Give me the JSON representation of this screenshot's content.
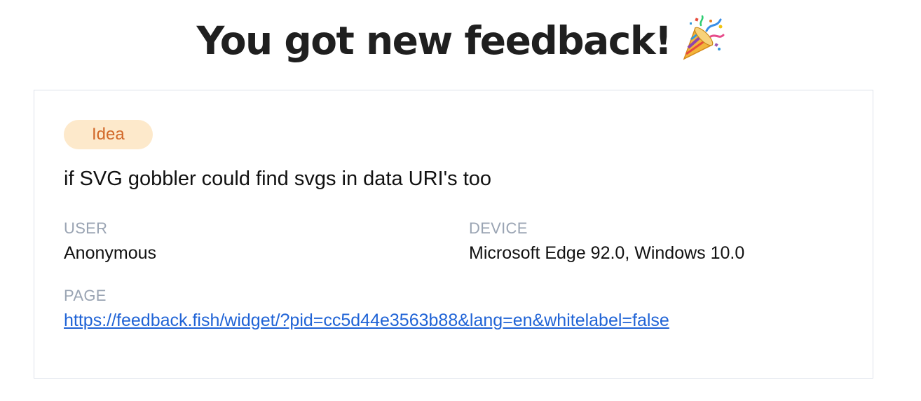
{
  "header": {
    "title": "You got new feedback!",
    "icon": "party-popper-icon"
  },
  "feedback": {
    "category": "Idea",
    "category_colors": {
      "background": "#fde9cb",
      "text": "#d2692a"
    },
    "message": "if SVG gobbler could find svgs in data URI's too",
    "user_label": "USER",
    "user_value": "Anonymous",
    "device_label": "DEVICE",
    "device_value": "Microsoft Edge 92.0, Windows 10.0",
    "page_label": "PAGE",
    "page_url": "https://feedback.fish/widget/?pid=cc5d44e3563b88&lang=en&whitelabel=false"
  },
  "colors": {
    "link": "#1f63d6",
    "label": "#9aa4b3",
    "border": "#dde2ea"
  }
}
